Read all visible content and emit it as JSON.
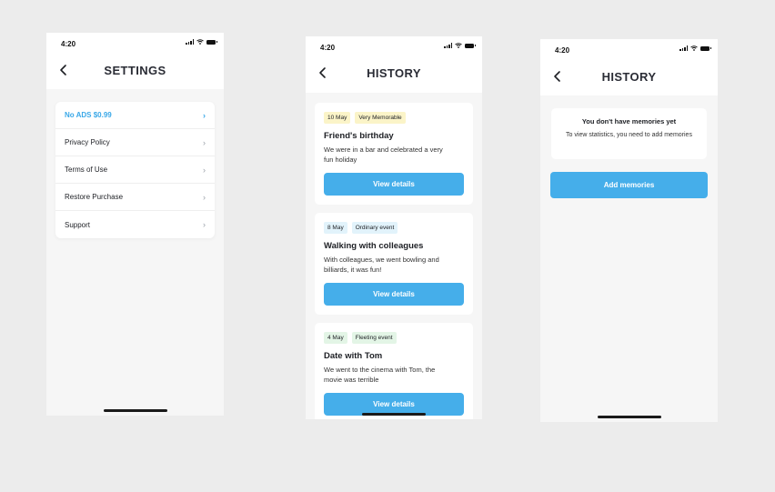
{
  "screens": {
    "settings": {
      "time": "4:20",
      "title": "SETTINGS",
      "items": [
        {
          "label": "No ADS $0.99",
          "accent": true
        },
        {
          "label": "Privacy Policy"
        },
        {
          "label": "Terms of Use"
        },
        {
          "label": "Restore Purchase"
        },
        {
          "label": "Support"
        }
      ]
    },
    "history": {
      "time": "4:20",
      "title": "HISTORY",
      "memories": [
        {
          "date": "10 May",
          "tag": "Very Memorable",
          "title": "Friend's birthday",
          "desc": "We were in a bar and celebrated a very fun holiday",
          "button": "View details"
        },
        {
          "date": "8 May",
          "tag": "Ordinary event",
          "title": "Walking with colleagues",
          "desc": "With colleagues, we went bowling and billiards, it was fun!",
          "button": "View details"
        },
        {
          "date": "4 May",
          "tag": "Fleeting event",
          "title": "Date with Tom",
          "desc": "We went to the cinema with Tom, the movie was terrible",
          "button": "View details"
        }
      ]
    },
    "history_empty": {
      "time": "4:20",
      "title": "HISTORY",
      "empty_title": "You don't have memories yet",
      "empty_desc": "To view statistics, you need to add memories",
      "add_button": "Add memories"
    }
  },
  "colors": {
    "accent": "#45aeea",
    "background": "#ececec",
    "screen": "#f6f6f6",
    "badge_yellow": "#fbf4c8",
    "badge_blue": "#e2f3fb",
    "badge_green": "#e3f5e6"
  },
  "icons": [
    "back-chevron-icon",
    "chevron-right-icon",
    "signal-icon",
    "wifi-icon",
    "battery-icon"
  ]
}
